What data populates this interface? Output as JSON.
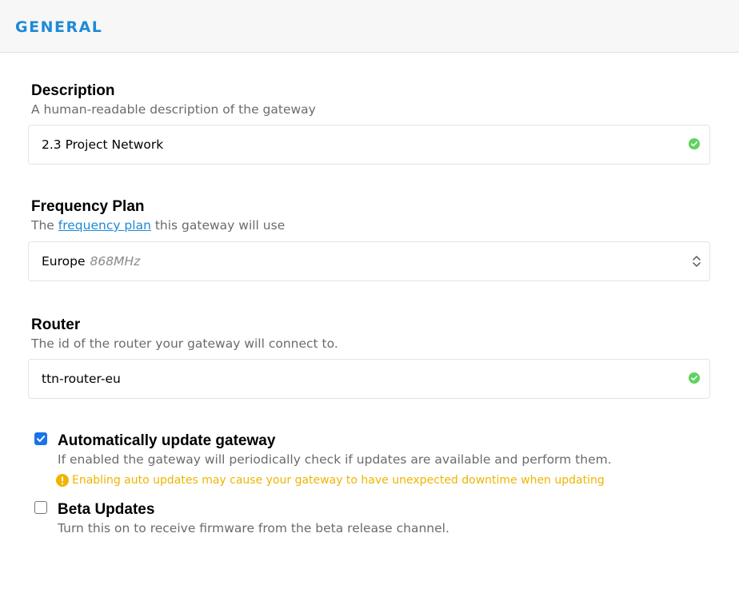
{
  "header": {
    "title": "GENERAL"
  },
  "fields": {
    "description": {
      "label": "Description",
      "help": "A human-readable description of the gateway",
      "value": "2.3 Project Network",
      "status_icon": "check-circle-icon"
    },
    "frequency_plan": {
      "label": "Frequency Plan",
      "help_prefix": "The ",
      "help_link": "frequency plan",
      "help_suffix": " this gateway will use",
      "selected_value": "Europe",
      "selected_sub": "868MHz",
      "control_icon": "select-arrows-icon"
    },
    "router": {
      "label": "Router",
      "help": "The id of the router your gateway will connect to.",
      "value": "ttn-router-eu",
      "status_icon": "check-circle-icon"
    }
  },
  "options": {
    "auto_update": {
      "label": "Automatically update gateway",
      "help": "If enabled the gateway will periodically check if updates are available and perform them.",
      "warning": "Enabling auto updates may cause your gateway to have unexpected downtime when updating",
      "checked": true
    },
    "beta_updates": {
      "label": "Beta Updates",
      "help": "Turn this on to receive firmware from the beta release channel.",
      "checked": false
    }
  },
  "colors": {
    "accent": "#1d8ad6",
    "success": "#5fd35f",
    "warning": "#f0b400",
    "checkbox": "#1a73e8"
  }
}
